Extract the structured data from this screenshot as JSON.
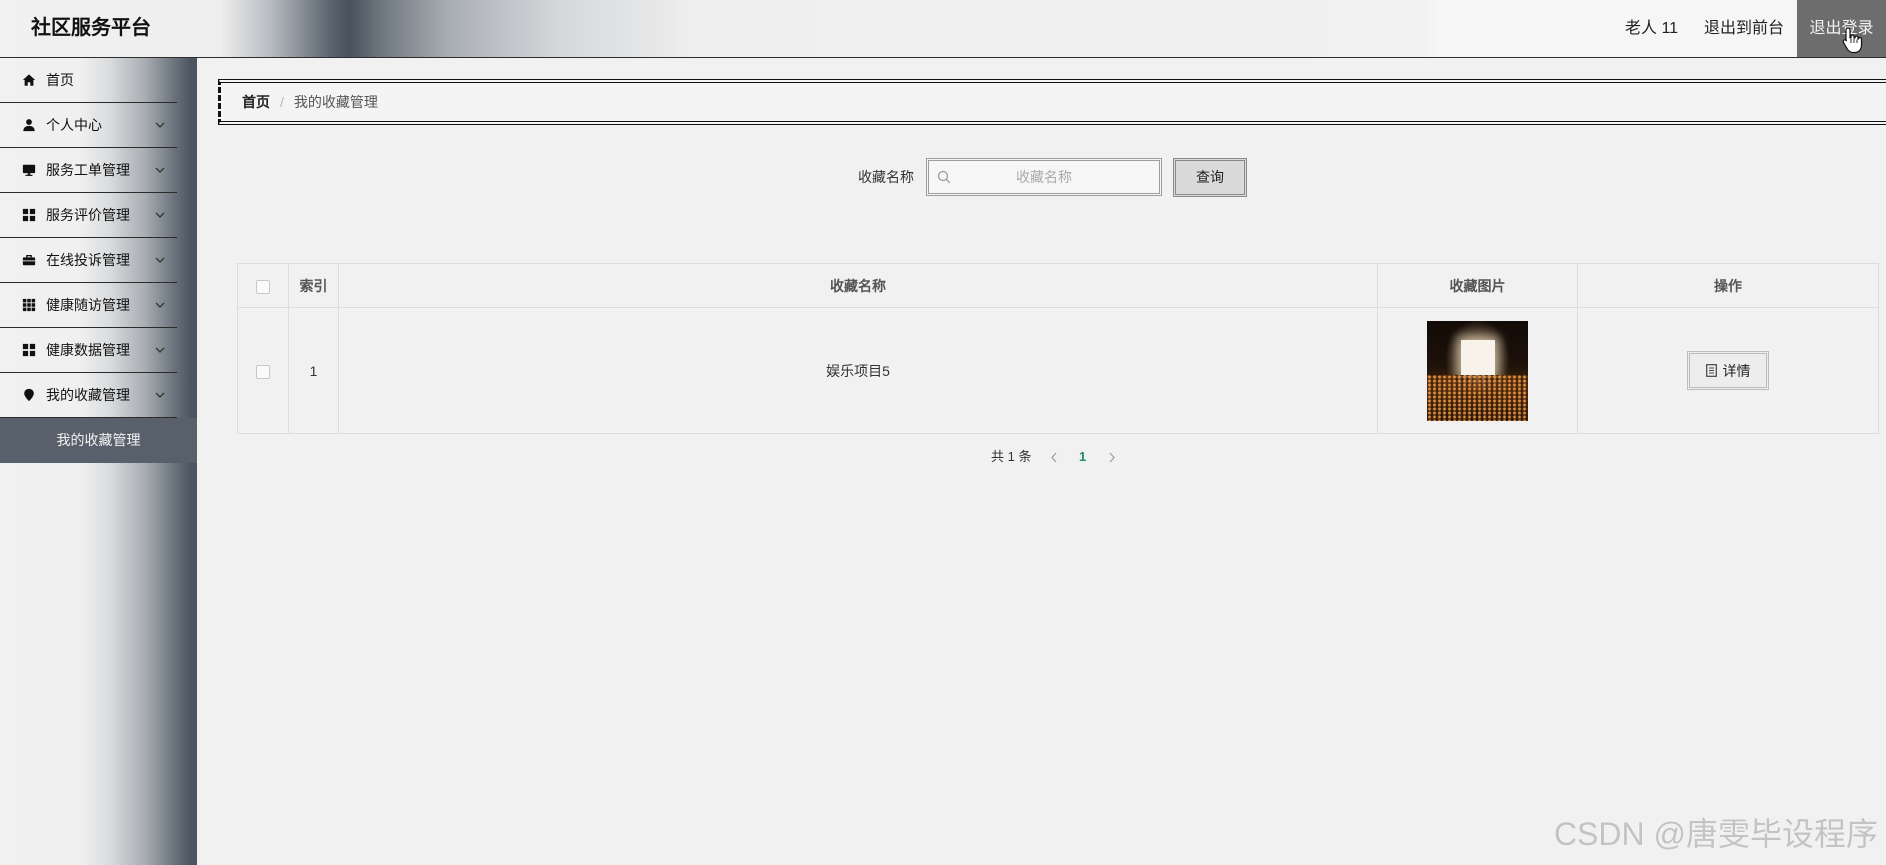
{
  "header": {
    "title": "社区服务平台",
    "user_name": "老人 11",
    "front_link": "退出到前台",
    "logout_button": "退出登录"
  },
  "sidebar": {
    "items": [
      {
        "label": "首页",
        "icon": "home-icon",
        "has_children": false
      },
      {
        "label": "个人中心",
        "icon": "user-icon",
        "has_children": true
      },
      {
        "label": "服务工单管理",
        "icon": "monitor-icon",
        "has_children": true
      },
      {
        "label": "服务评价管理",
        "icon": "grid-icon",
        "has_children": true
      },
      {
        "label": "在线投诉管理",
        "icon": "briefcase-icon",
        "has_children": true
      },
      {
        "label": "健康随访管理",
        "icon": "apps-icon",
        "has_children": true
      },
      {
        "label": "健康数据管理",
        "icon": "grid-icon",
        "has_children": true
      },
      {
        "label": "我的收藏管理",
        "icon": "pin-icon",
        "has_children": true,
        "expanded": true,
        "children": [
          {
            "label": "我的收藏管理",
            "active": true
          }
        ]
      }
    ]
  },
  "breadcrumb": {
    "home": "首页",
    "separator": "/",
    "current": "我的收藏管理"
  },
  "search": {
    "label": "收藏名称",
    "placeholder": "收藏名称",
    "value": "",
    "button": "查询"
  },
  "table": {
    "columns": [
      "索引",
      "收藏名称",
      "收藏图片",
      "操作"
    ],
    "rows": [
      {
        "index": "1",
        "name": "娱乐项目5",
        "action": "详情",
        "selected": false
      }
    ]
  },
  "pagination": {
    "total_text": "共 1 条",
    "current_page": "1"
  },
  "watermark": "CSDN @唐雯毕设程序",
  "colors": {
    "logout_bg": "#6d6d6d",
    "submenu_bg": "#58616b",
    "page_active": "#1e8c6e",
    "header_accent": "#48525d"
  }
}
